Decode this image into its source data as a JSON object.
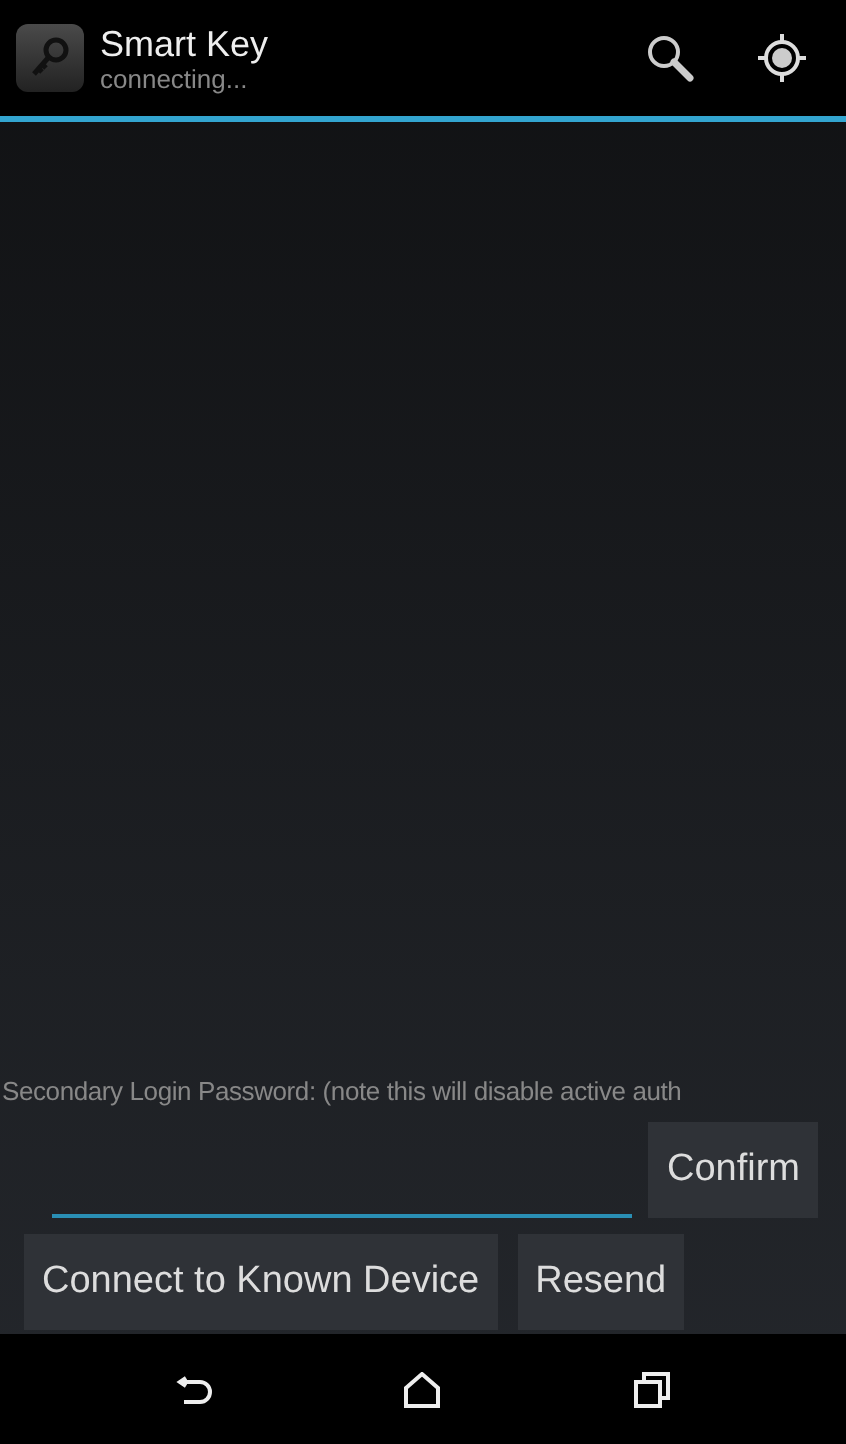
{
  "action_bar": {
    "title": "Smart Key",
    "subtitle": "connecting..."
  },
  "password": {
    "label": "Secondary Login Password: (note this will disable active auth",
    "focused": true
  },
  "buttons": [
    {
      "label": "Confirm"
    },
    {
      "label": "Connect to Known Device"
    },
    {
      "label": "Resend"
    }
  ]
}
